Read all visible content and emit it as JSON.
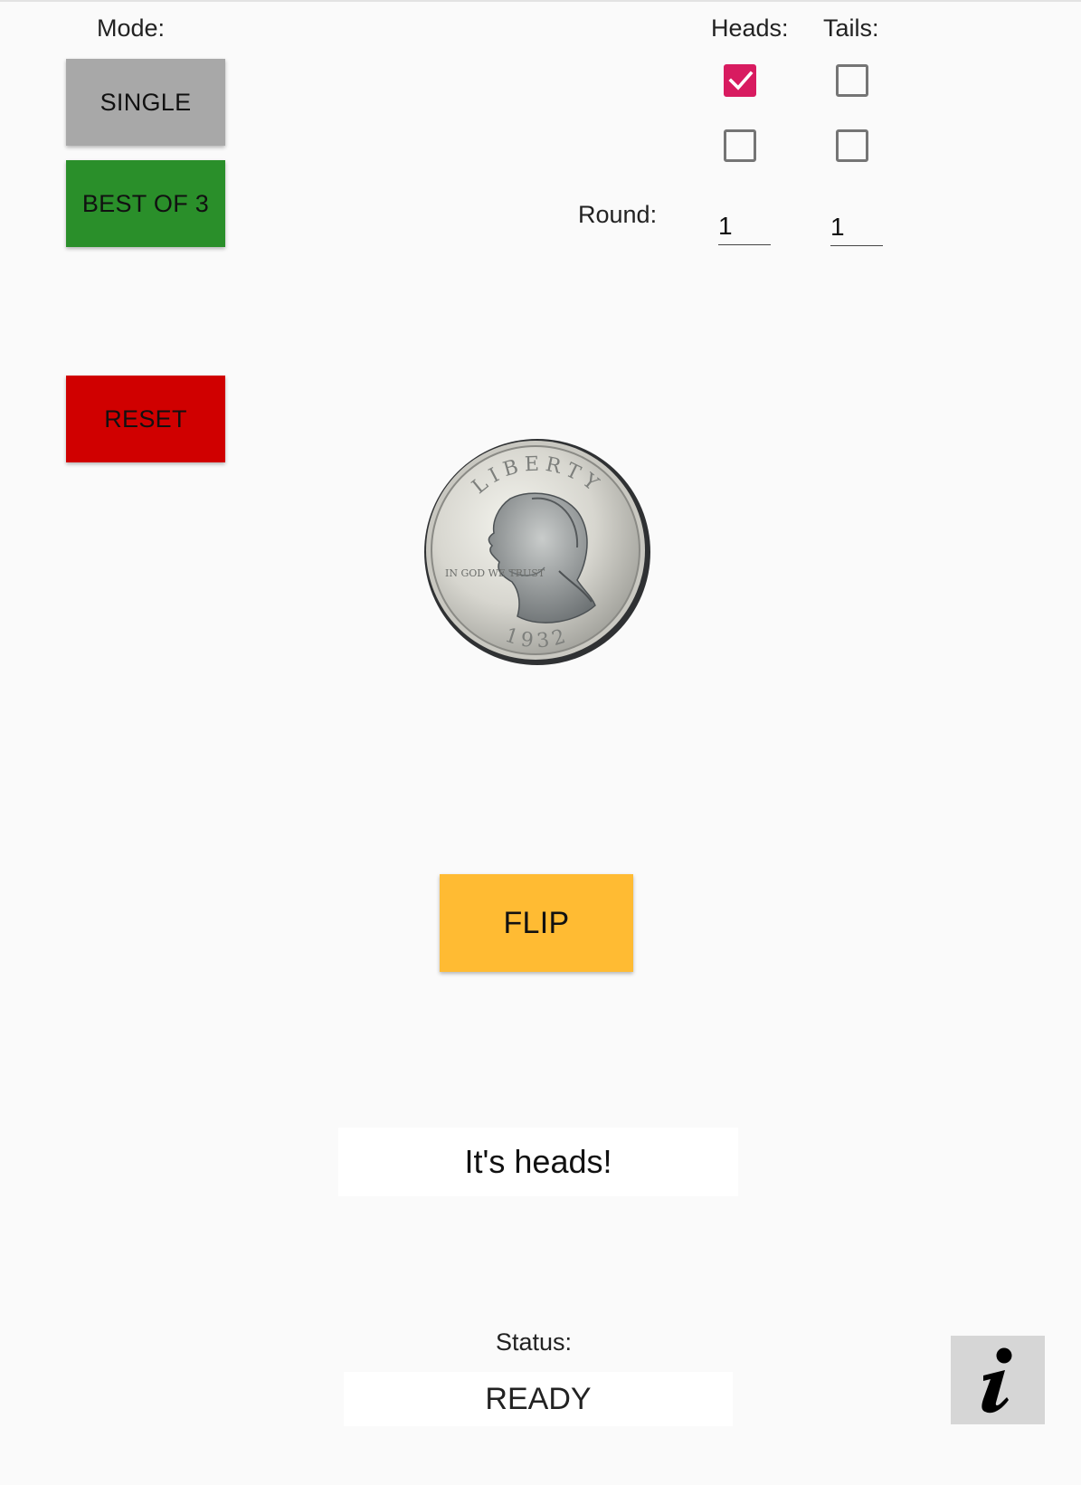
{
  "mode": {
    "label": "Mode:",
    "single_label": "SINGLE",
    "best_of_3_label": "BEST OF 3",
    "reset_label": "RESET"
  },
  "score": {
    "heads_label": "Heads:",
    "tails_label": "Tails:",
    "heads_checks": [
      true,
      false
    ],
    "tails_checks": [
      false,
      false
    ],
    "round_label": "Round:",
    "heads_round": "1",
    "tails_round": "1"
  },
  "coin": {
    "side": "heads",
    "legend_top": "LIBERTY",
    "motto": "IN GOD WE TRUST",
    "year": "1932"
  },
  "actions": {
    "flip_label": "FLIP"
  },
  "result": {
    "text": "It's heads!"
  },
  "status": {
    "label": "Status:",
    "value": "READY"
  },
  "info": {
    "icon": "info-icon"
  },
  "colors": {
    "single_button": "#a8a8a8",
    "best_of_3_button": "#2a8f2a",
    "reset_button": "#d00000",
    "flip_button": "#ffbb33",
    "checkbox_checked": "#d81b60",
    "background": "#fafafa"
  }
}
